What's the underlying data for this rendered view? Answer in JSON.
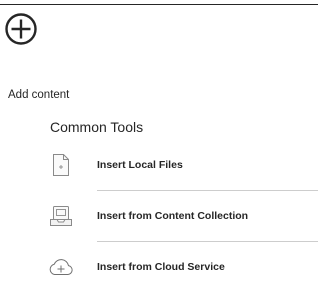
{
  "header": {
    "add_icon": "plus-circle-icon"
  },
  "add_content": {
    "title": "Add content",
    "group_title": "Common Tools",
    "tools": [
      {
        "label": "Insert Local Files",
        "icon": "file-icon"
      },
      {
        "label": "Insert from Content Collection",
        "icon": "content-collection-icon"
      },
      {
        "label": "Insert from Cloud Service",
        "icon": "cloud-add-icon"
      }
    ]
  },
  "colors": {
    "text": "#262626",
    "divider": "#cdcdcd",
    "icon_stroke": "#8a8a8a"
  }
}
